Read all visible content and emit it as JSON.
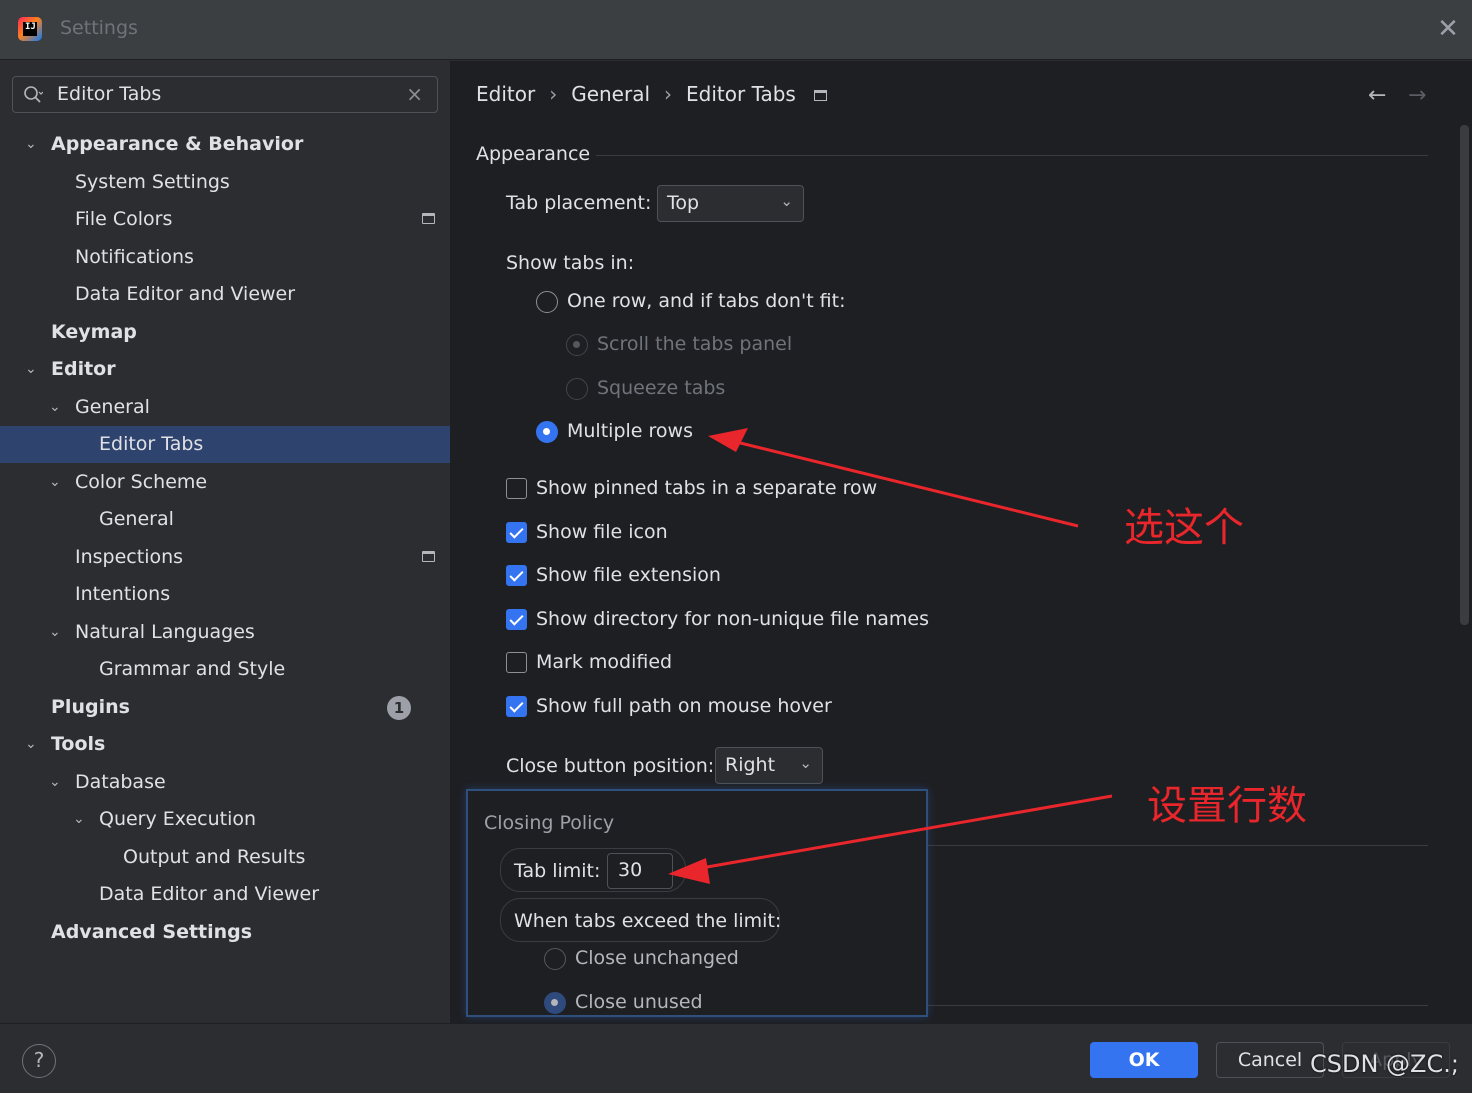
{
  "window": {
    "title": "Settings",
    "logo_text": "IJ"
  },
  "search": {
    "value": "Editor Tabs",
    "clear": "×"
  },
  "tree": [
    {
      "label": "Appearance & Behavior",
      "bold": true,
      "level": 0,
      "expanded": true
    },
    {
      "label": "System Settings",
      "level": 1
    },
    {
      "label": "File Colors",
      "level": 1,
      "project_icon": true
    },
    {
      "label": "Notifications",
      "level": 1
    },
    {
      "label": "Data Editor and Viewer",
      "level": 1
    },
    {
      "label": "Keymap",
      "bold": true,
      "level": 0
    },
    {
      "label": "Editor",
      "bold": true,
      "level": 0,
      "expanded": true
    },
    {
      "label": "General",
      "level": 1,
      "expanded": true
    },
    {
      "label": "Editor Tabs",
      "level": 2,
      "selected": true
    },
    {
      "label": "Color Scheme",
      "level": 1,
      "expanded": true
    },
    {
      "label": "General",
      "level": 2
    },
    {
      "label": "Inspections",
      "level": 1,
      "project_icon": true
    },
    {
      "label": "Intentions",
      "level": 1
    },
    {
      "label": "Natural Languages",
      "level": 1,
      "expanded": true
    },
    {
      "label": "Grammar and Style",
      "level": 2
    },
    {
      "label": "Plugins",
      "bold": true,
      "level": 0,
      "badge": "1"
    },
    {
      "label": "Tools",
      "bold": true,
      "level": 0,
      "expanded": true
    },
    {
      "label": "Database",
      "level": 1,
      "expanded": true
    },
    {
      "label": "Query Execution",
      "level": 2,
      "expanded": true
    },
    {
      "label": "Output and Results",
      "level": 3
    },
    {
      "label": "Data Editor and Viewer",
      "level": 2
    },
    {
      "label": "Advanced Settings",
      "bold": true,
      "level": 0
    }
  ],
  "breadcrumb": {
    "items": [
      "Editor",
      "General",
      "Editor Tabs"
    ],
    "sep": "›"
  },
  "nav": {
    "back": "←",
    "forward": "→"
  },
  "appearance": {
    "title": "Appearance",
    "tab_placement_label": "Tab placement:",
    "tab_placement_value": "Top",
    "show_tabs_in_label": "Show tabs in:",
    "one_row": "One row, and if tabs don't fit:",
    "scroll_panel": "Scroll the tabs panel",
    "squeeze_tabs": "Squeeze tabs",
    "multiple_rows": "Multiple rows",
    "pinned_separate": "Show pinned tabs in a separate row",
    "show_file_icon": "Show file icon",
    "show_file_ext": "Show file extension",
    "show_directory": "Show directory for non-unique file names",
    "mark_modified": "Mark modified",
    "show_full_path": "Show full path on mouse hover",
    "close_button_label": "Close button position:",
    "close_button_value": "Right"
  },
  "closing_policy": {
    "title": "Closing Policy",
    "tab_limit_label": "Tab limit:",
    "tab_limit_value": "30",
    "exceed_label": "When tabs exceed the limit:",
    "close_unchanged": "Close unchanged",
    "close_unused": "Close unused"
  },
  "annotations": {
    "choose_this": "选这个",
    "set_rows": "设置行数"
  },
  "footer": {
    "help": "?",
    "ok": "OK",
    "cancel": "Cancel",
    "apply": "Apply"
  },
  "watermark": "CSDN @ZC.;",
  "colors": {
    "accent": "#3574f0",
    "annotation": "#e8262b",
    "selection": "#2e436e"
  }
}
